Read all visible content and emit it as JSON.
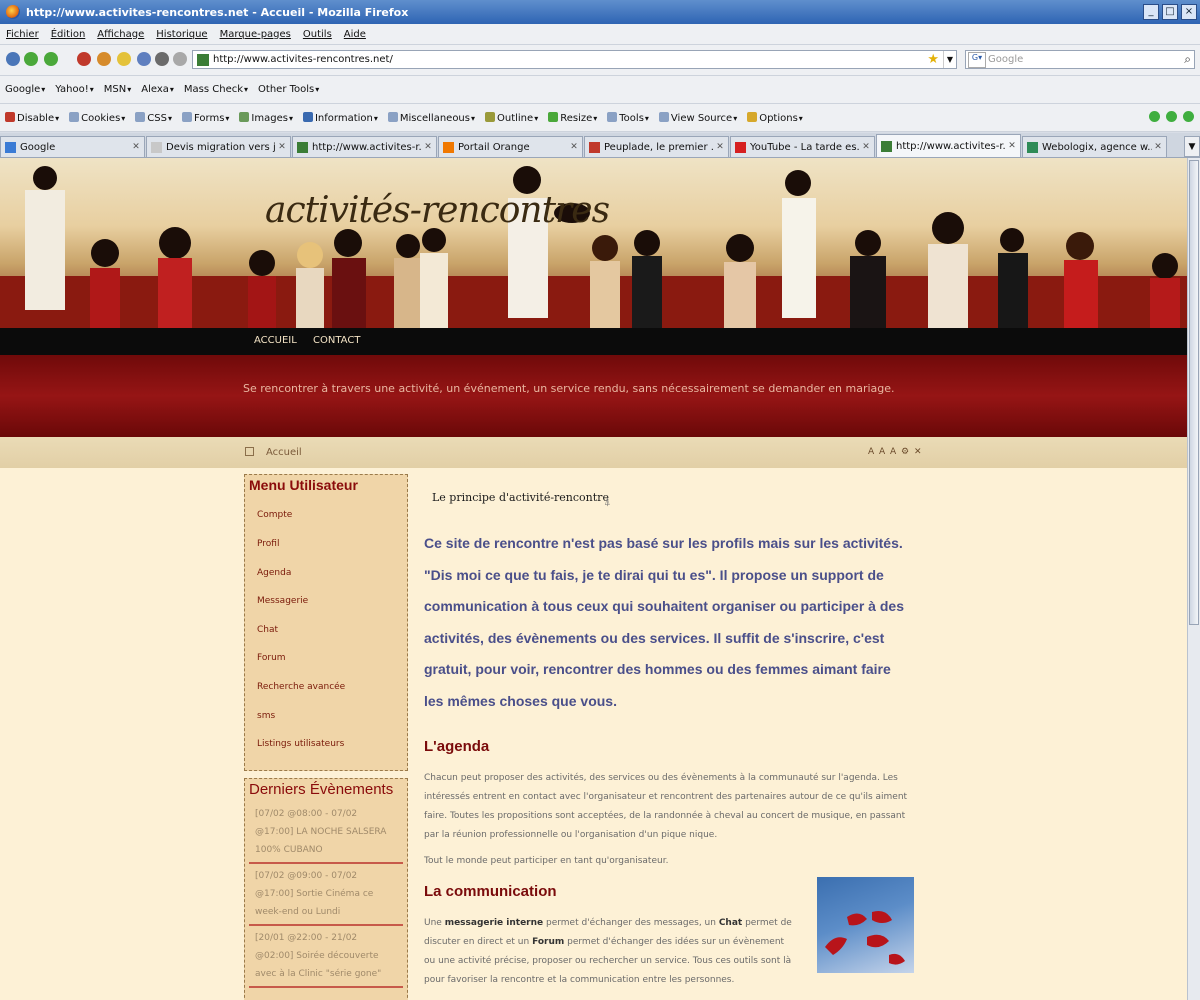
{
  "window": {
    "title": "http://www.activites-rencontres.net - Accueil - Mozilla Firefox"
  },
  "menubar": [
    "Fichier",
    "Édition",
    "Affichage",
    "Historique",
    "Marque-pages",
    "Outils",
    "Aide"
  ],
  "navbar": {
    "url": "http://www.activites-rencontres.net/",
    "search_placeholder": "Google"
  },
  "bookmarks": [
    "Google",
    "Yahoo!",
    "MSN",
    "Alexa",
    "Mass Check",
    "Other Tools"
  ],
  "webdev": [
    "Disable",
    "Cookies",
    "CSS",
    "Forms",
    "Images",
    "Information",
    "Miscellaneous",
    "Outline",
    "Resize",
    "Tools",
    "View Source",
    "Options"
  ],
  "tabs": [
    {
      "label": "Google",
      "icon_color": "#3a7bd5"
    },
    {
      "label": "Devis migration vers j...",
      "icon_color": "#c8c8c8"
    },
    {
      "label": "http://www.activites-r...",
      "icon_color": "#3b7d36"
    },
    {
      "label": "Portail Orange",
      "icon_color": "#f07800"
    },
    {
      "label": "Peuplade, le premier ...",
      "icon_color": "#c0392b"
    },
    {
      "label": "YouTube - La tarde es...",
      "icon_color": "#d62020"
    },
    {
      "label": "http://www.activites-r...",
      "icon_color": "#3b7d36",
      "active": true
    },
    {
      "label": "Webologix, agence w...",
      "icon_color": "#2e8b57"
    }
  ],
  "site": {
    "logo": "activités-rencontres",
    "nav": [
      "ACCUEIL",
      "CONTACT"
    ],
    "tagline": "Se rencontrer à travers une activité, un événement, un service rendu, sans nécessairement se demander en mariage.",
    "breadcrumb": "Accueil",
    "font_controls": "A A A ⚙ ✕"
  },
  "sidebar": {
    "menu_title": "Menu Utilisateur",
    "menu_items": [
      "Compte",
      "Profil",
      "Agenda",
      "Messagerie",
      "Chat",
      "Forum",
      "Recherche avancée",
      "sms",
      "Listings utilisateurs"
    ],
    "events_title": "Derniers Évènements",
    "events": [
      "[07/02 @08:00 - 07/02 @17:00] LA NOCHE SALSERA 100% CUBANO",
      "[07/02 @09:00 - 07/02 @17:00] Sortie Cinéma ce week-end ou Lundi",
      "[20/01 @22:00 - 21/02 @02:00] Soirée découverte avec à la Clinic \"série gone\""
    ]
  },
  "content": {
    "title": "Le principe d'activité-rencontre",
    "lead": "Ce site de rencontre n'est pas basé sur les profils mais sur les activités. \"Dis moi ce que tu fais, je te dirai qui tu es\". Il propose un support de communication à tous ceux qui souhaitent organiser ou participer à des activités, des évènements ou des services. Il suffit de s'inscrire, c'est gratuit, pour voir, rencontrer des hommes ou des femmes aimant faire les mêmes choses que vous.",
    "agenda_title": "L'agenda",
    "agenda_p1": "Chacun peut proposer des activités, des services ou des évènements à la communauté sur l'agenda. Les intéressés entrent en contact avec l'organisateur et rencontrent des partenaires autour de ce qu'ils aiment faire. Toutes les propositions sont acceptées, de la randonnée à cheval au concert de musique, en passant par la réunion professionnelle ou l'organisation d'un pique nique.",
    "agenda_p2": "Tout le monde peut participer en tant qu'organisateur.",
    "comm_title": "La communication",
    "comm_p_before": "Une ",
    "comm_b1": "messagerie interne",
    "comm_p_mid1": " permet d'échanger des messages, un ",
    "comm_b2": "Chat",
    "comm_p_mid2": " permet de discuter en direct et un ",
    "comm_b3": "Forum",
    "comm_p_after": " permet d'échanger des idées sur un évènement ou une activité précise, proposer ou rechercher un service. Tous ces outils sont là pour favoriser la rencontre et la communication entre les personnes."
  }
}
